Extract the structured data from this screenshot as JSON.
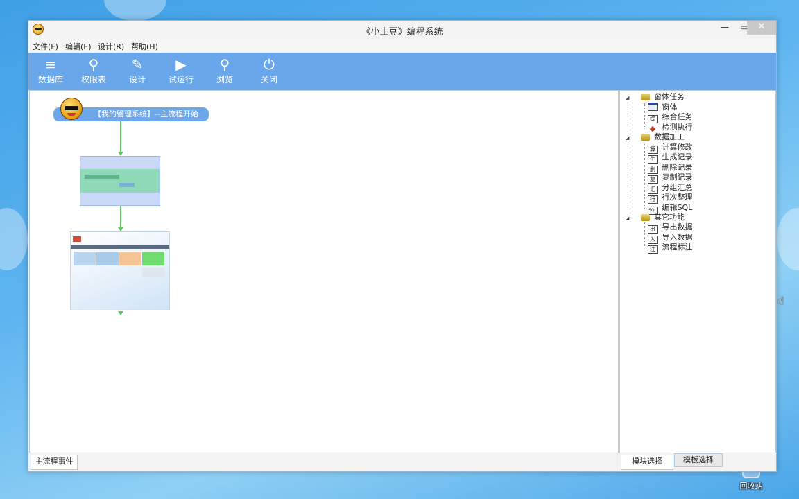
{
  "window": {
    "title": "《小土豆》编程系统",
    "min": "—",
    "max": "▭",
    "close": "✕"
  },
  "menu": [
    "文件(F)",
    "编辑(E)",
    "设计(R)",
    "帮助(H)"
  ],
  "toolbar": [
    {
      "label": "数据库",
      "icon": "database-icon",
      "glyph": "≡"
    },
    {
      "label": "权限表",
      "icon": "key-icon",
      "glyph": "⚲"
    },
    {
      "label": "设计",
      "icon": "pencil-icon",
      "glyph": "✎"
    },
    {
      "label": "试运行",
      "icon": "play-icon",
      "glyph": "▶"
    },
    {
      "label": "浏览",
      "icon": "search-icon",
      "glyph": "⚲"
    },
    {
      "label": "关闭",
      "icon": "power-icon",
      "glyph": "⏻"
    }
  ],
  "flow": {
    "start_label": "【我的管理系统】--主流程开始"
  },
  "bottom_tabs": {
    "main_events": "主流程事件"
  },
  "tree": {
    "groups": [
      {
        "label": "窗体任务",
        "items": [
          {
            "label": "窗体",
            "icon_text": ""
          },
          {
            "label": "综合任务",
            "icon_text": "综"
          },
          {
            "label": "检测执行",
            "icon_text": "◆"
          }
        ]
      },
      {
        "label": "数据加工",
        "items": [
          {
            "label": "计算修改",
            "icon_text": "算"
          },
          {
            "label": "生成记录",
            "icon_text": "生"
          },
          {
            "label": "删除记录",
            "icon_text": "删"
          },
          {
            "label": "复制记录",
            "icon_text": "复"
          },
          {
            "label": "分组汇总",
            "icon_text": "汇"
          },
          {
            "label": "行次整理",
            "icon_text": "行"
          },
          {
            "label": "编辑SQL",
            "icon_text": "SQL"
          }
        ]
      },
      {
        "label": "其它功能",
        "items": [
          {
            "label": "导出数据",
            "icon_text": "出"
          },
          {
            "label": "导入数据",
            "icon_text": "入"
          },
          {
            "label": "流程标注",
            "icon_text": "注"
          }
        ]
      }
    ]
  },
  "right_tabs": {
    "module": "模块选择",
    "template": "模板选择"
  },
  "desktop": {
    "recycle_bin": "回收站"
  }
}
